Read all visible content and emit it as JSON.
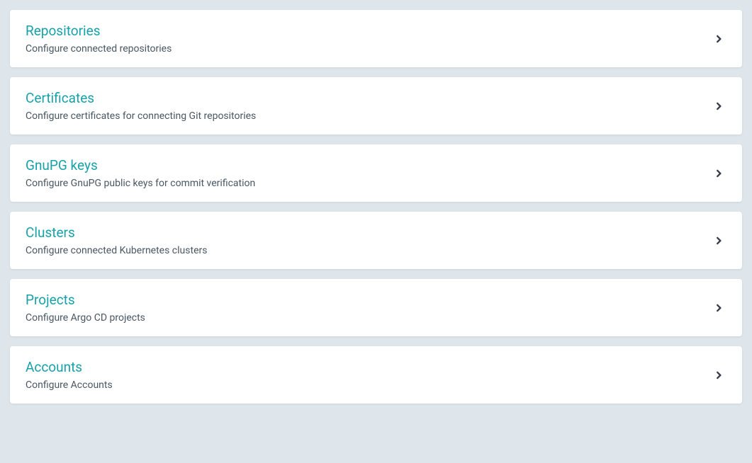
{
  "settings": [
    {
      "id": "repositories",
      "title": "Repositories",
      "description": "Configure connected repositories"
    },
    {
      "id": "certificates",
      "title": "Certificates",
      "description": "Configure certificates for connecting Git repositories"
    },
    {
      "id": "gnupg-keys",
      "title": "GnuPG keys",
      "description": "Configure GnuPG public keys for commit verification"
    },
    {
      "id": "clusters",
      "title": "Clusters",
      "description": "Configure connected Kubernetes clusters"
    },
    {
      "id": "projects",
      "title": "Projects",
      "description": "Configure Argo CD projects"
    },
    {
      "id": "accounts",
      "title": "Accounts",
      "description": "Configure Accounts"
    }
  ]
}
